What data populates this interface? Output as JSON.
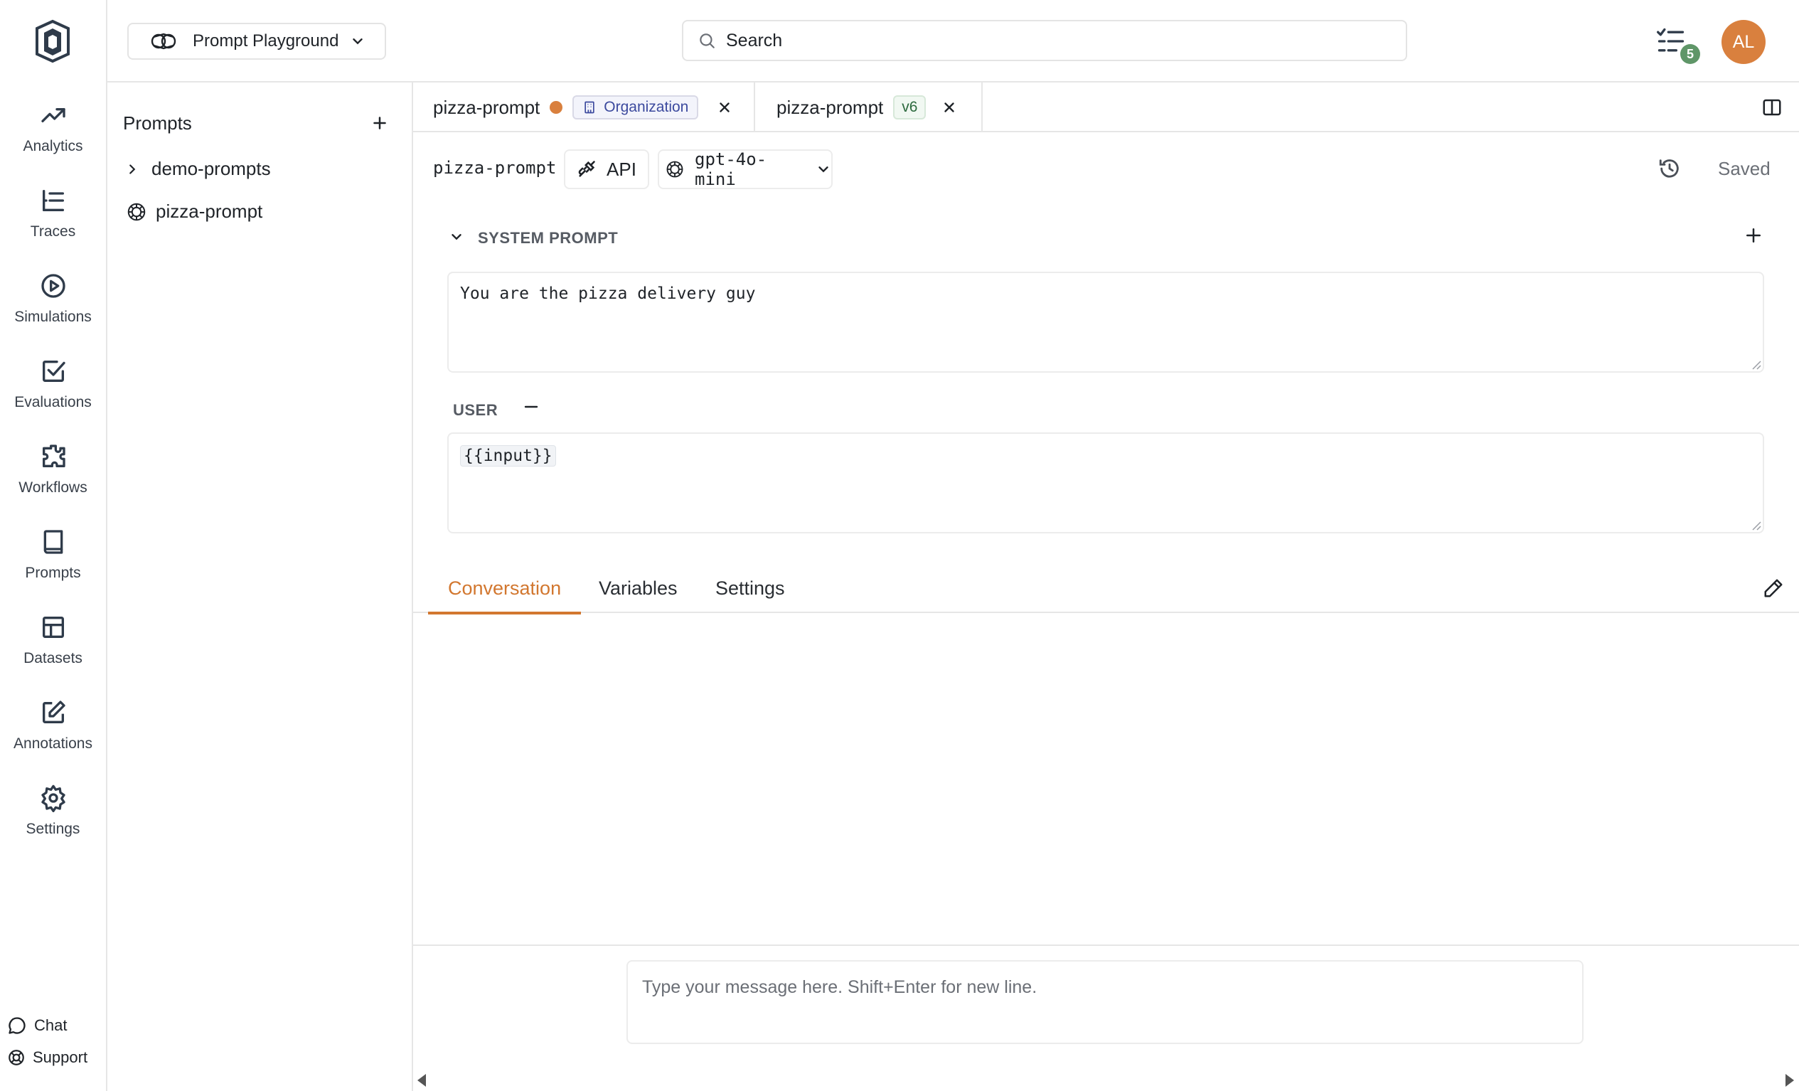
{
  "sidebar": {
    "items": [
      {
        "label": "Analytics",
        "icon": "trending-up-icon"
      },
      {
        "label": "Traces",
        "icon": "list-tree-icon"
      },
      {
        "label": "Simulations",
        "icon": "play-circle-icon"
      },
      {
        "label": "Evaluations",
        "icon": "check-square-icon"
      },
      {
        "label": "Workflows",
        "icon": "puzzle-icon"
      },
      {
        "label": "Prompts",
        "icon": "book-icon"
      },
      {
        "label": "Datasets",
        "icon": "table-icon"
      },
      {
        "label": "Annotations",
        "icon": "pencil-square-icon"
      },
      {
        "label": "Settings",
        "icon": "gear-icon"
      }
    ],
    "footer": [
      {
        "label": "Chat",
        "icon": "chat-bubble-icon"
      },
      {
        "label": "Support",
        "icon": "lifebuoy-icon"
      }
    ]
  },
  "header": {
    "workspace": "Prompt Playground",
    "search_placeholder": "Search",
    "tasks_count": "5",
    "avatar_initials": "AL"
  },
  "prompts_panel": {
    "title": "Prompts",
    "tree": [
      {
        "label": "demo-prompts",
        "type": "folder"
      },
      {
        "label": "pizza-prompt",
        "type": "prompt"
      }
    ]
  },
  "tabs": [
    {
      "name": "pizza-prompt",
      "unsaved": true,
      "scope": "Organization"
    },
    {
      "name": "pizza-prompt",
      "version": "v6"
    }
  ],
  "editor": {
    "prompt_name": "pizza-prompt",
    "api_label": "API",
    "model": "gpt-4o-mini",
    "status": "Saved",
    "system_label": "SYSTEM PROMPT",
    "system_text": "You are the pizza delivery guy",
    "user_label": "USER",
    "user_text": "{{input}}"
  },
  "subtabs": [
    "Conversation",
    "Variables",
    "Settings"
  ],
  "composer": {
    "placeholder": "Type your message here. Shift+Enter for new line."
  },
  "colors": {
    "accent": "#d2772f",
    "avatar": "#d9803e",
    "badge": "#5f9668",
    "unsaved_dot": "#d9803e"
  }
}
